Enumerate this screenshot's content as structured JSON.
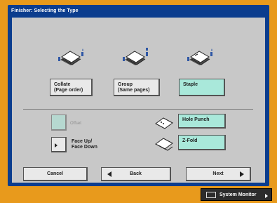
{
  "window": {
    "title": "Finisher: Selecting the Type"
  },
  "types": {
    "collate": "Collate\n(Page order)",
    "group": "Group\n(Same pages)",
    "staple": "Staple"
  },
  "options": {
    "offset": "Offset",
    "face_up_down": "Face Up/\nFace Down",
    "hole_punch": "Hole Punch",
    "z_fold": "Z-Fold"
  },
  "navigation": {
    "cancel": "Cancel",
    "back": "Back",
    "next": "Next"
  },
  "status_bar": {
    "system_monitor": "System Monitor"
  },
  "colors": {
    "panel_title_bar": "#0b3d8e",
    "outer_frame": "#e89a1c",
    "selected_button": "#a9e8da",
    "panel_body": "#c8c8c8"
  },
  "selected_type": "Staple",
  "icons": {
    "collate": "collate-sorter-icon",
    "group": "group-sorter-icon",
    "staple": "staple-sorter-icon",
    "hole_punch": "hole-punch-paper-icon",
    "z_fold": "z-fold-paper-icon"
  }
}
